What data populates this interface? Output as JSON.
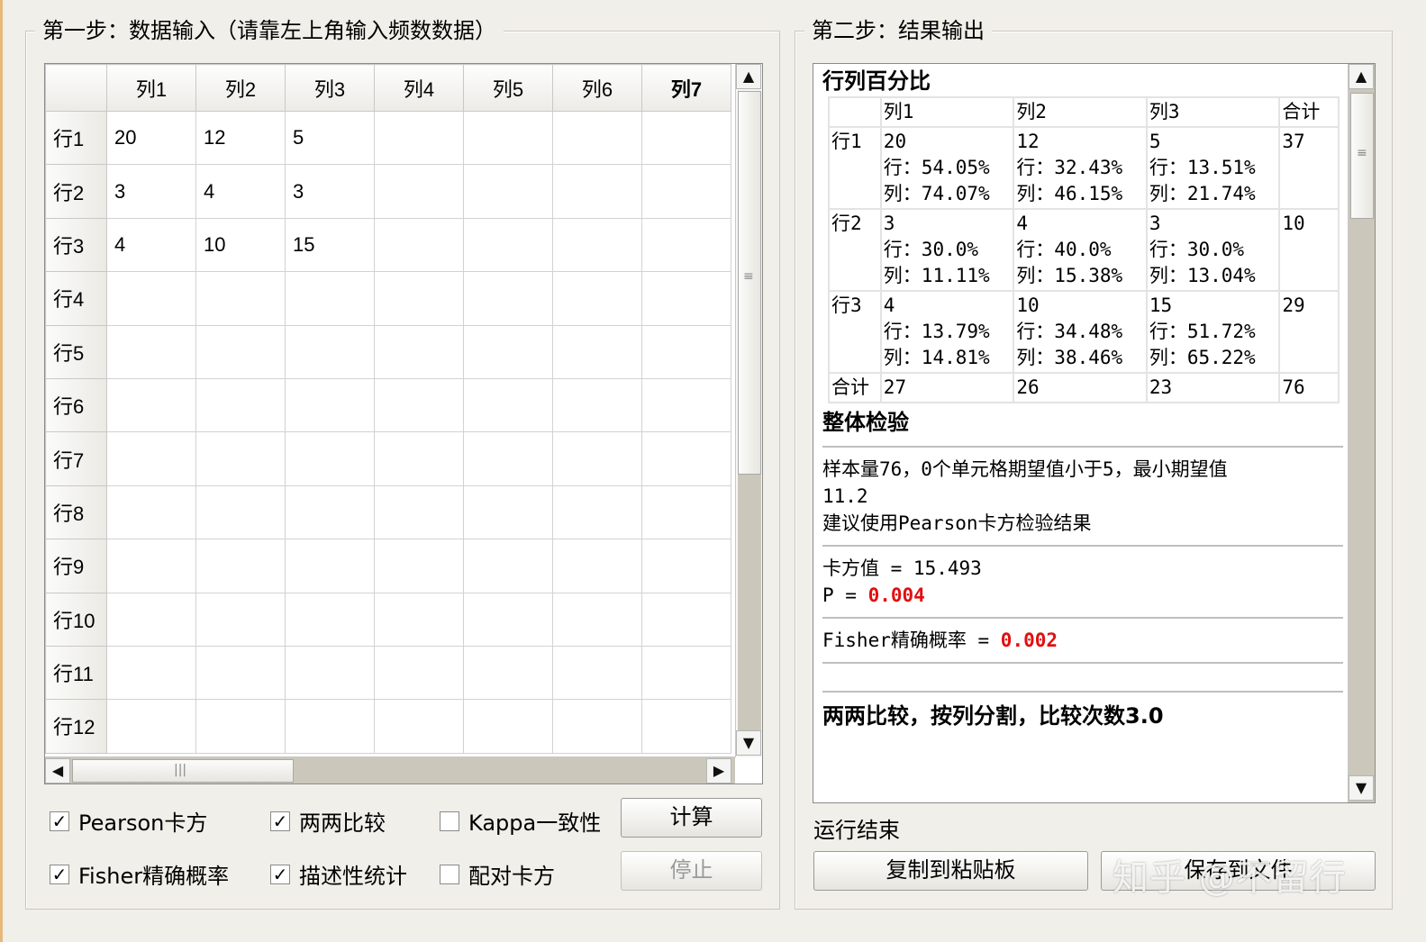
{
  "step1": {
    "title": "第一步：数据输入（请靠左上角输入频数数据）",
    "columns": [
      "列1",
      "列2",
      "列3",
      "列4",
      "列5",
      "列6",
      "列7"
    ],
    "rows": [
      {
        "label": "行1",
        "cells": [
          "20",
          "12",
          "5",
          "",
          "",
          "",
          ""
        ]
      },
      {
        "label": "行2",
        "cells": [
          "3",
          "4",
          "3",
          "",
          "",
          "",
          ""
        ]
      },
      {
        "label": "行3",
        "cells": [
          "4",
          "10",
          "15",
          "",
          "",
          "",
          ""
        ]
      },
      {
        "label": "行4",
        "cells": [
          "",
          "",
          "",
          "",
          "",
          "",
          ""
        ]
      },
      {
        "label": "行5",
        "cells": [
          "",
          "",
          "",
          "",
          "",
          "",
          ""
        ]
      },
      {
        "label": "行6",
        "cells": [
          "",
          "",
          "",
          "",
          "",
          "",
          ""
        ]
      },
      {
        "label": "行7",
        "cells": [
          "",
          "",
          "",
          "",
          "",
          "",
          ""
        ]
      },
      {
        "label": "行8",
        "cells": [
          "",
          "",
          "",
          "",
          "",
          "",
          ""
        ]
      },
      {
        "label": "行9",
        "cells": [
          "",
          "",
          "",
          "",
          "",
          "",
          ""
        ]
      },
      {
        "label": "行10",
        "cells": [
          "",
          "",
          "",
          "",
          "",
          "",
          ""
        ]
      },
      {
        "label": "行11",
        "cells": [
          "",
          "",
          "",
          "",
          "",
          "",
          ""
        ]
      },
      {
        "label": "行12",
        "cells": [
          "",
          "",
          "",
          "",
          "",
          "",
          ""
        ]
      }
    ],
    "options": {
      "pearson": {
        "label": "Pearson卡方",
        "checked": true
      },
      "pairwise": {
        "label": "两两比较",
        "checked": true
      },
      "kappa": {
        "label": "Kappa一致性",
        "checked": false
      },
      "fisher": {
        "label": "Fisher精确概率",
        "checked": true
      },
      "descriptive": {
        "label": "描述性统计",
        "checked": true
      },
      "paired": {
        "label": "配对卡方",
        "checked": false
      }
    },
    "calc_button": "计算",
    "stop_button": "停止"
  },
  "step2": {
    "title": "第二步：结果输出",
    "pct_title": "行列百分比",
    "pct_header": [
      "",
      "列1",
      "列2",
      "列3",
      "合计"
    ],
    "pct_rows": [
      {
        "label": "行1",
        "cells": [
          [
            "20",
            "行：54.05%",
            "列：74.07%"
          ],
          [
            "12",
            "行：32.43%",
            "列：46.15%"
          ],
          [
            "5",
            "行：13.51%",
            "列：21.74%"
          ]
        ],
        "total": "37"
      },
      {
        "label": "行2",
        "cells": [
          [
            "3",
            "行：30.0%",
            "列：11.11%"
          ],
          [
            "4",
            "行：40.0%",
            "列：15.38%"
          ],
          [
            "3",
            "行：30.0%",
            "列：13.04%"
          ]
        ],
        "total": "10"
      },
      {
        "label": "行3",
        "cells": [
          [
            "4",
            "行：13.79%",
            "列：14.81%"
          ],
          [
            "10",
            "行：34.48%",
            "列：38.46%"
          ],
          [
            "15",
            "行：51.72%",
            "列：65.22%"
          ]
        ],
        "total": "29"
      }
    ],
    "pct_total_row": [
      "合计",
      "27",
      "26",
      "23",
      "76"
    ],
    "overall_title": "整体检验",
    "overall_line1": "样本量76，0个单元格期望值小于5，最小期望值",
    "overall_line2": "11.2",
    "overall_line3": "建议使用Pearson卡方检验结果",
    "chi_line": "卡方值 = 15.493",
    "p_prefix": "P = ",
    "p_value": "0.004",
    "fisher_prefix": "Fisher精确概率 = ",
    "fisher_value": "0.002",
    "pairwise_title": "两两比较，按列分割，比较次数3.0",
    "status": "运行结束",
    "copy_button": "复制到粘贴板",
    "save_button": "保存到文件"
  },
  "watermark": "知乎 @不留行"
}
